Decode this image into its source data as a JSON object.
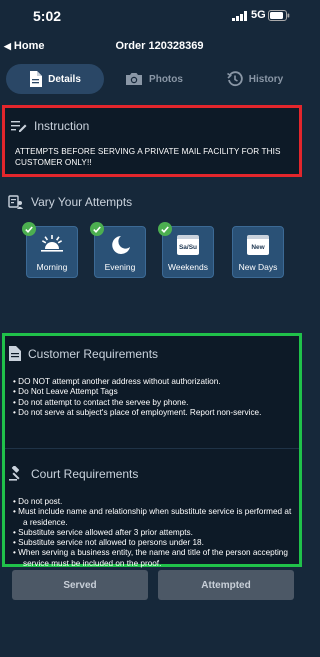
{
  "status_bar": {
    "time": "5:02",
    "network": "5G"
  },
  "nav": {
    "back_label": "Home",
    "title": "Order 120328369"
  },
  "tabs": [
    {
      "label": "Details",
      "icon": "document-icon",
      "active": true
    },
    {
      "label": "Photos",
      "icon": "camera-icon",
      "active": false
    },
    {
      "label": "History",
      "icon": "history-icon",
      "active": false
    }
  ],
  "instruction": {
    "heading": "Instruction",
    "text": "ATTEMPTS BEFORE SERVING A PRIVATE MAIL FACILITY FOR THIS CUSTOMER ONLY!!"
  },
  "vary_attempts": {
    "heading": "Vary Your Attempts",
    "tiles": [
      {
        "label": "Morning",
        "icon": "sunrise-icon",
        "checked": true
      },
      {
        "label": "Evening",
        "icon": "moon-icon",
        "checked": true
      },
      {
        "label": "Weekends",
        "icon": "calendar-icon",
        "icon_text": "Sa/Su",
        "checked": true
      },
      {
        "label": "New Days",
        "icon": "calendar-icon",
        "icon_text": "New",
        "checked": false
      }
    ]
  },
  "customer_requirements": {
    "heading": "Customer Requirements",
    "items": [
      "DO NOT attempt another address without authorization.",
      "Do Not Leave Attempt Tags",
      "Do not attempt to contact the servee by phone.",
      "Do not serve at subject's place of employment. Report non-service."
    ]
  },
  "court_requirements": {
    "heading": "Court Requirements",
    "items": [
      "Do not post.",
      "Must include name and relationship when substitute service is performed at a residence.",
      "Substitute service allowed after 3 prior attempts.",
      "Substitute service not allowed to persons under 18.",
      "When serving a business entity, the name and title of the person accepting service must be included on the proof."
    ]
  },
  "actions": {
    "served_label": "Served",
    "attempted_label": "Attempted"
  },
  "colors": {
    "background": "#16283a",
    "instruction_border": "#e3262c",
    "requirements_border": "#20c14a",
    "tile": "#2a5176",
    "check": "#4caf50",
    "button": "#4c5866"
  }
}
